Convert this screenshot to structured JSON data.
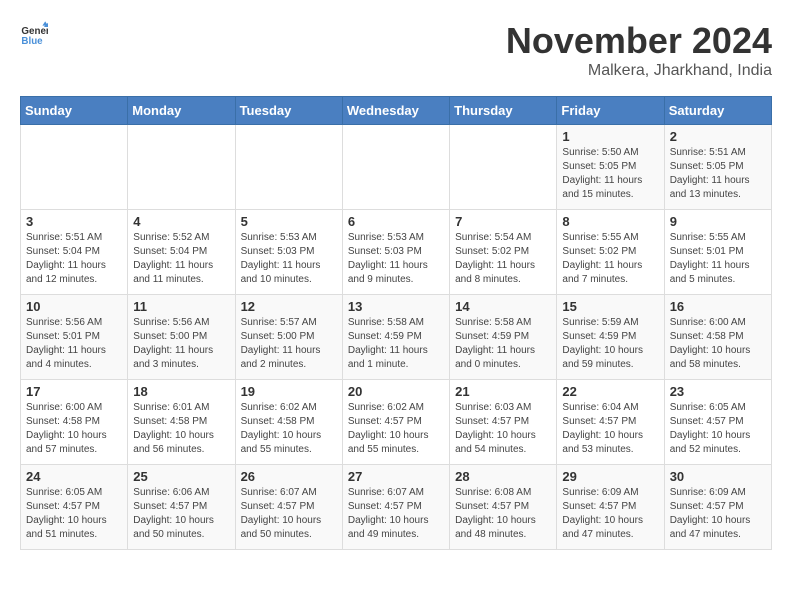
{
  "header": {
    "logo_general": "General",
    "logo_blue": "Blue",
    "month": "November 2024",
    "location": "Malkera, Jharkhand, India"
  },
  "weekdays": [
    "Sunday",
    "Monday",
    "Tuesday",
    "Wednesday",
    "Thursday",
    "Friday",
    "Saturday"
  ],
  "weeks": [
    [
      {
        "day": "",
        "info": ""
      },
      {
        "day": "",
        "info": ""
      },
      {
        "day": "",
        "info": ""
      },
      {
        "day": "",
        "info": ""
      },
      {
        "day": "",
        "info": ""
      },
      {
        "day": "1",
        "info": "Sunrise: 5:50 AM\nSunset: 5:05 PM\nDaylight: 11 hours and 15 minutes."
      },
      {
        "day": "2",
        "info": "Sunrise: 5:51 AM\nSunset: 5:05 PM\nDaylight: 11 hours and 13 minutes."
      }
    ],
    [
      {
        "day": "3",
        "info": "Sunrise: 5:51 AM\nSunset: 5:04 PM\nDaylight: 11 hours and 12 minutes."
      },
      {
        "day": "4",
        "info": "Sunrise: 5:52 AM\nSunset: 5:04 PM\nDaylight: 11 hours and 11 minutes."
      },
      {
        "day": "5",
        "info": "Sunrise: 5:53 AM\nSunset: 5:03 PM\nDaylight: 11 hours and 10 minutes."
      },
      {
        "day": "6",
        "info": "Sunrise: 5:53 AM\nSunset: 5:03 PM\nDaylight: 11 hours and 9 minutes."
      },
      {
        "day": "7",
        "info": "Sunrise: 5:54 AM\nSunset: 5:02 PM\nDaylight: 11 hours and 8 minutes."
      },
      {
        "day": "8",
        "info": "Sunrise: 5:55 AM\nSunset: 5:02 PM\nDaylight: 11 hours and 7 minutes."
      },
      {
        "day": "9",
        "info": "Sunrise: 5:55 AM\nSunset: 5:01 PM\nDaylight: 11 hours and 5 minutes."
      }
    ],
    [
      {
        "day": "10",
        "info": "Sunrise: 5:56 AM\nSunset: 5:01 PM\nDaylight: 11 hours and 4 minutes."
      },
      {
        "day": "11",
        "info": "Sunrise: 5:56 AM\nSunset: 5:00 PM\nDaylight: 11 hours and 3 minutes."
      },
      {
        "day": "12",
        "info": "Sunrise: 5:57 AM\nSunset: 5:00 PM\nDaylight: 11 hours and 2 minutes."
      },
      {
        "day": "13",
        "info": "Sunrise: 5:58 AM\nSunset: 4:59 PM\nDaylight: 11 hours and 1 minute."
      },
      {
        "day": "14",
        "info": "Sunrise: 5:58 AM\nSunset: 4:59 PM\nDaylight: 11 hours and 0 minutes."
      },
      {
        "day": "15",
        "info": "Sunrise: 5:59 AM\nSunset: 4:59 PM\nDaylight: 10 hours and 59 minutes."
      },
      {
        "day": "16",
        "info": "Sunrise: 6:00 AM\nSunset: 4:58 PM\nDaylight: 10 hours and 58 minutes."
      }
    ],
    [
      {
        "day": "17",
        "info": "Sunrise: 6:00 AM\nSunset: 4:58 PM\nDaylight: 10 hours and 57 minutes."
      },
      {
        "day": "18",
        "info": "Sunrise: 6:01 AM\nSunset: 4:58 PM\nDaylight: 10 hours and 56 minutes."
      },
      {
        "day": "19",
        "info": "Sunrise: 6:02 AM\nSunset: 4:58 PM\nDaylight: 10 hours and 55 minutes."
      },
      {
        "day": "20",
        "info": "Sunrise: 6:02 AM\nSunset: 4:57 PM\nDaylight: 10 hours and 55 minutes."
      },
      {
        "day": "21",
        "info": "Sunrise: 6:03 AM\nSunset: 4:57 PM\nDaylight: 10 hours and 54 minutes."
      },
      {
        "day": "22",
        "info": "Sunrise: 6:04 AM\nSunset: 4:57 PM\nDaylight: 10 hours and 53 minutes."
      },
      {
        "day": "23",
        "info": "Sunrise: 6:05 AM\nSunset: 4:57 PM\nDaylight: 10 hours and 52 minutes."
      }
    ],
    [
      {
        "day": "24",
        "info": "Sunrise: 6:05 AM\nSunset: 4:57 PM\nDaylight: 10 hours and 51 minutes."
      },
      {
        "day": "25",
        "info": "Sunrise: 6:06 AM\nSunset: 4:57 PM\nDaylight: 10 hours and 50 minutes."
      },
      {
        "day": "26",
        "info": "Sunrise: 6:07 AM\nSunset: 4:57 PM\nDaylight: 10 hours and 50 minutes."
      },
      {
        "day": "27",
        "info": "Sunrise: 6:07 AM\nSunset: 4:57 PM\nDaylight: 10 hours and 49 minutes."
      },
      {
        "day": "28",
        "info": "Sunrise: 6:08 AM\nSunset: 4:57 PM\nDaylight: 10 hours and 48 minutes."
      },
      {
        "day": "29",
        "info": "Sunrise: 6:09 AM\nSunset: 4:57 PM\nDaylight: 10 hours and 47 minutes."
      },
      {
        "day": "30",
        "info": "Sunrise: 6:09 AM\nSunset: 4:57 PM\nDaylight: 10 hours and 47 minutes."
      }
    ]
  ]
}
